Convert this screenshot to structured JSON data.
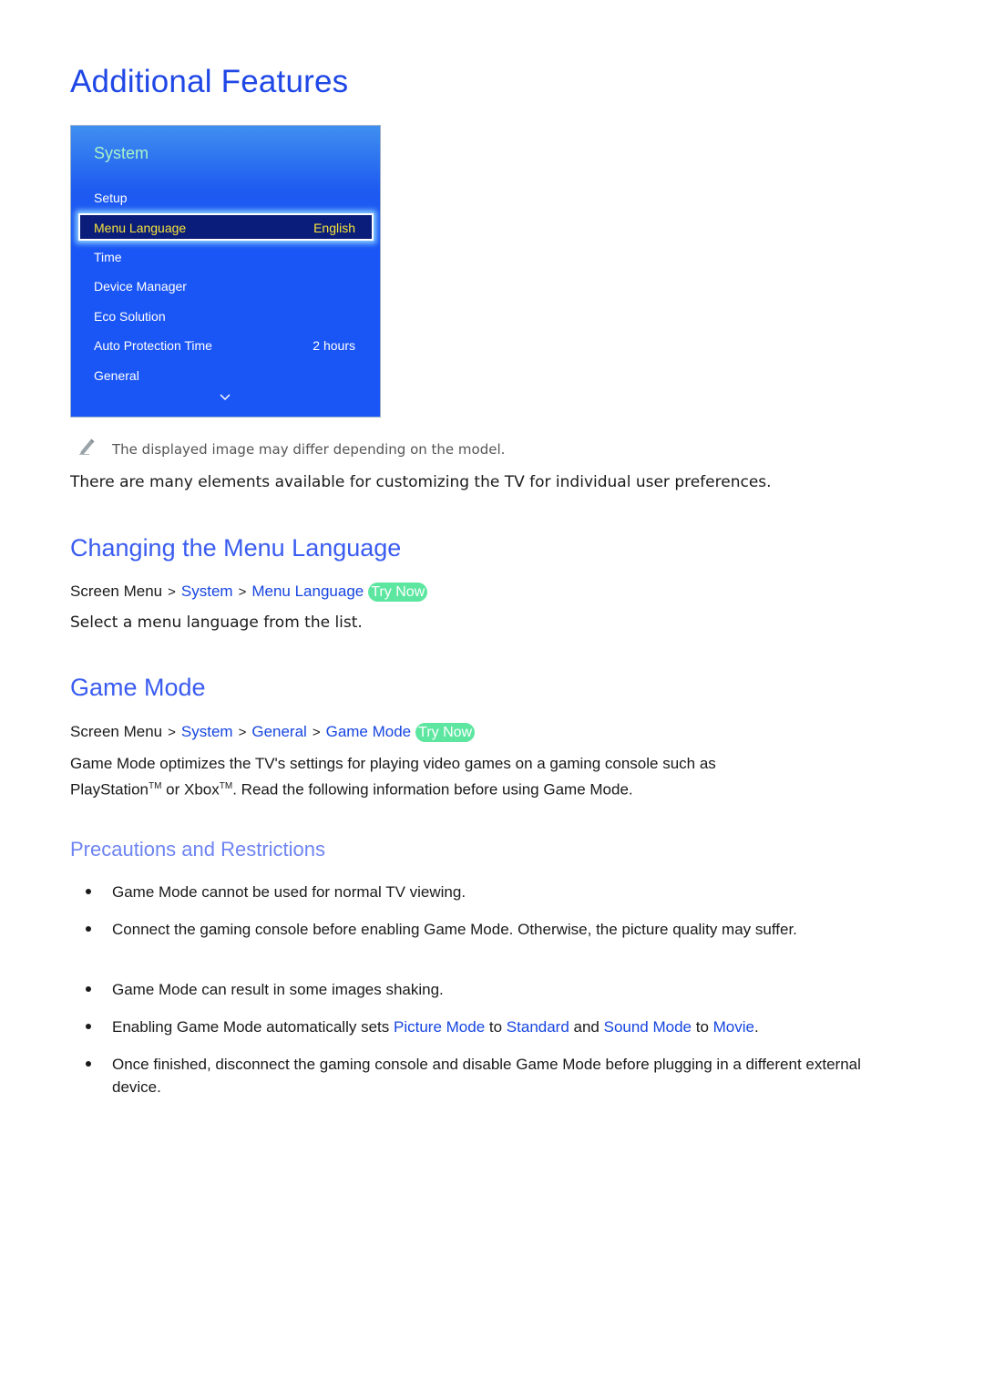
{
  "page_title": "Additional Features",
  "tv_menu": {
    "title": "System",
    "items": [
      {
        "label": "Setup",
        "value": ""
      },
      {
        "label": "Menu Language",
        "value": "English",
        "selected": true
      },
      {
        "label": "Time",
        "value": ""
      },
      {
        "label": "Device Manager",
        "value": ""
      },
      {
        "label": "Eco Solution",
        "value": ""
      },
      {
        "label": "Auto Protection Time",
        "value": "2 hours"
      },
      {
        "label": "General",
        "value": ""
      }
    ],
    "more_icon": "chevron-down-icon"
  },
  "note": {
    "icon": "pencil-icon",
    "text": "The displayed image may differ depending on the model."
  },
  "intro": "There are many elements available for customizing the TV for individual user preferences.",
  "section_menu_language": {
    "heading": "Changing the Menu Language",
    "breadcrumb": [
      "Screen Menu",
      "System",
      "Menu Language"
    ],
    "try_now": "Try Now",
    "description": "Select a menu language from the list."
  },
  "section_game_mode": {
    "heading": "Game Mode",
    "breadcrumb": [
      "Screen Menu",
      "System",
      "General",
      "Game Mode"
    ],
    "try_now": "Try Now",
    "description_line1": "Game Mode optimizes the TV's settings for playing video games on a gaming console such as",
    "description_line2_a": "PlayStation",
    "tm": "TM",
    "description_line2_b": " or Xbox",
    "description_line2_c": ". Read the following information before using Game Mode.",
    "subheading": "Precautions and Restrictions",
    "bullets": [
      "Game Mode cannot be used for normal TV viewing.",
      "Connect the gaming console before enabling Game Mode. Otherwise, the picture quality may suffer.",
      "Game Mode can result in some images shaking.",
      {
        "parts": [
          "Enabling Game Mode automatically sets ",
          "Picture Mode",
          " to ",
          "Standard",
          " and ",
          "Sound Mode",
          " to ",
          "Movie",
          "."
        ]
      },
      "Once finished, disconnect the gaming console and disable Game Mode before plugging in a different external device."
    ]
  },
  "colors": {
    "heading": "#1f47e6",
    "link": "#1746e0",
    "try_now_badge": "#5ce6a0",
    "menu_bg": "#1a55f5",
    "menu_selected_bg": "#0b1d7a",
    "menu_selected_text": "#f5e23a",
    "menu_title": "#a9f2c8"
  }
}
